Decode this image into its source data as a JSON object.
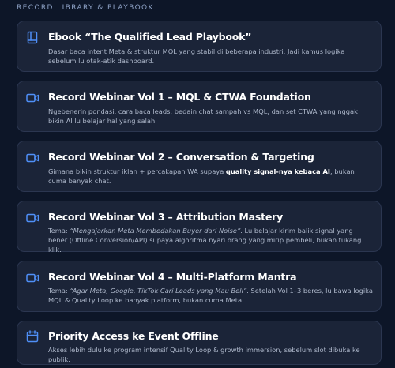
{
  "section_title": "RECORD LIBRARY & PLAYBOOK",
  "accent_color": "#4f8ff7",
  "cards": [
    {
      "icon": "book-icon",
      "title": "Ebook “The Qualified Lead Playbook”",
      "desc": "Dasar baca intent Meta & struktur MQL yang stabil di beberapa industri. Jadi kamus logika sebelum lu otak-atik dashboard."
    },
    {
      "icon": "video-camera-icon",
      "title": "Record Webinar Vol 1 – MQL & CTWA Foundation",
      "desc": "Ngebenerin pondasi: cara baca leads, bedain chat sampah vs MQL, dan set CTWA yang nggak bikin AI lu belajar hal yang salah."
    },
    {
      "icon": "video-camera-icon",
      "title": "Record Webinar Vol 2 – Conversation & Targeting",
      "desc_before": "Gimana bikin struktur iklan + percakapan WA supaya ",
      "desc_strong": "quality signal-nya kebaca AI",
      "desc_after": ", bukan cuma banyak chat."
    },
    {
      "icon": "video-camera-icon",
      "title": "Record Webinar Vol 3 – Attribution Mastery",
      "desc_before": "Tema: ",
      "desc_em": "“Mengajarkan Meta Membedakan Buyer dari Noise”",
      "desc_after": ". Lu belajar kirim balik signal yang bener (Offline Conversion/API) supaya algoritma nyari orang yang mirip pembeli, bukan tukang klik."
    },
    {
      "icon": "video-camera-icon",
      "title": "Record Webinar Vol 4 – Multi-Platform Mantra",
      "desc_before": "Tema: ",
      "desc_em": "“Agar Meta, Google, TikTok Cari Leads yang Mau Beli”",
      "desc_after": ". Setelah Vol 1–3 beres, lu bawa logika MQL & Quality Loop ke banyak platform, bukan cuma Meta."
    },
    {
      "icon": "calendar-icon",
      "title": "Priority Access ke Event Offline",
      "desc": "Akses lebih dulu ke program intensif Quality Loop & growth immersion, sebelum slot dibuka ke publik."
    }
  ]
}
